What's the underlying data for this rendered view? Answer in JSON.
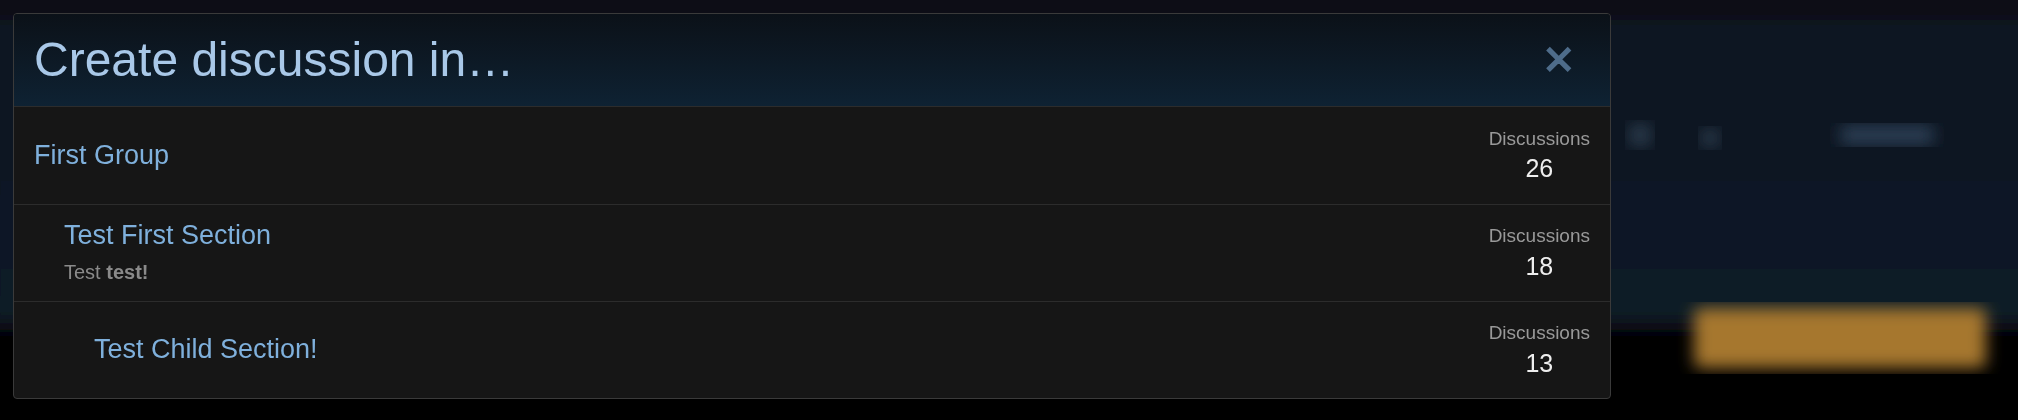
{
  "dialog": {
    "title": "Create discussion in…",
    "close_icon": "✕",
    "nodes": [
      {
        "title": "First Group",
        "stat_label": "Discussions",
        "count": "26",
        "children": [
          {
            "title": "Test First Section",
            "description": "Test **test!**",
            "stat_label": "Discussions",
            "count": "18",
            "children": [
              {
                "title": "Test Child Section!",
                "stat_label": "Discussions",
                "count": "13"
              }
            ]
          }
        ]
      }
    ]
  }
}
